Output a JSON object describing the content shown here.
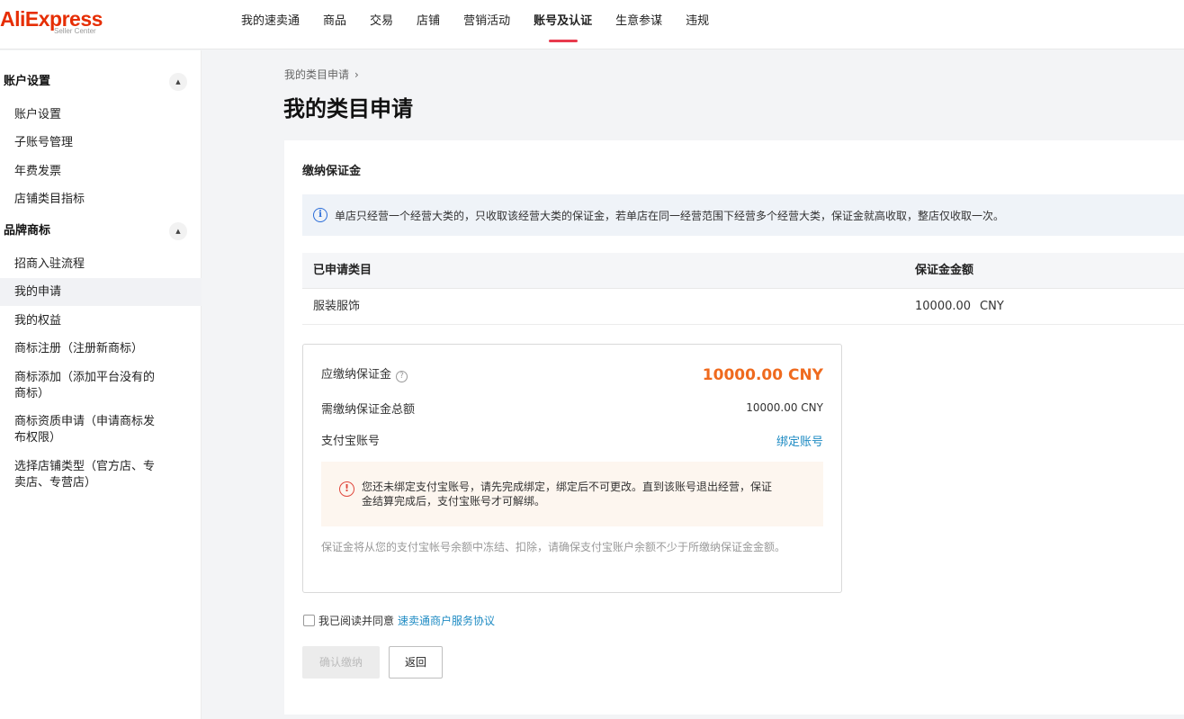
{
  "brand": {
    "logo_text": "AliExpress",
    "logo_sub": "Seller Center",
    "accent_color": "#e62e04"
  },
  "topnav": {
    "items": [
      {
        "label": "我的速卖通"
      },
      {
        "label": "商品"
      },
      {
        "label": "交易"
      },
      {
        "label": "店铺"
      },
      {
        "label": "营销活动"
      },
      {
        "label": "账号及认证",
        "active": true
      },
      {
        "label": "生意参谋"
      },
      {
        "label": "违规"
      }
    ]
  },
  "sidebar": {
    "groups": [
      {
        "title": "账户设置",
        "toggle_icon": "caret-up-icon",
        "items": [
          "账户设置",
          "子账号管理",
          "年费发票",
          "店铺类目指标"
        ]
      },
      {
        "title": "品牌商标",
        "toggle_icon": "caret-up-icon",
        "items": [
          "招商入驻流程",
          "我的申请",
          "我的权益",
          "商标注册（注册新商标）",
          "商标添加（添加平台没有的商标）",
          "商标资质申请（申请商标发布权限）",
          "选择店铺类型（官方店、专卖店、专营店）"
        ]
      }
    ],
    "active_item": "我的申请"
  },
  "main": {
    "breadcrumb": {
      "item": "我的类目申请",
      "separator": "›"
    },
    "title": "我的类目申请",
    "section_title": "缴纳保证金",
    "notice": "单店只经营一个经营大类的，只收取该经营大类的保证金，若单店在同一经营范围下经营多个经营大类，保证金就高收取，整店仅收取一次。",
    "table": {
      "headers": [
        "已申请类目",
        "保证金金额"
      ],
      "rows": [
        {
          "category": "服装服饰",
          "amount": "10000.00",
          "currency": "CNY"
        }
      ]
    },
    "payment": {
      "due_label": "应缴纳保证金",
      "due_amount": "10000.00 CNY",
      "total_label": "需缴纳保证金总额",
      "total_amount": "10000.00 CNY",
      "alipay_label": "支付宝账号",
      "bind_link": "绑定账号",
      "warning": "您还未绑定支付宝账号，请先完成绑定，绑定后不可更改。直到该账号退出经营，保证金结算完成后，支付宝账号才可解绑。",
      "note": "保证金将从您的支付宝帐号余额中冻结、扣除，请确保支付宝账户余额不少于所缴纳保证金金额。",
      "amount_color": "#ef6a1e"
    },
    "agreement": {
      "label": "我已阅读并同意",
      "link": "速卖通商户服务协议",
      "checked": false
    },
    "buttons": {
      "confirm": "确认缴纳",
      "back": "返回"
    }
  }
}
